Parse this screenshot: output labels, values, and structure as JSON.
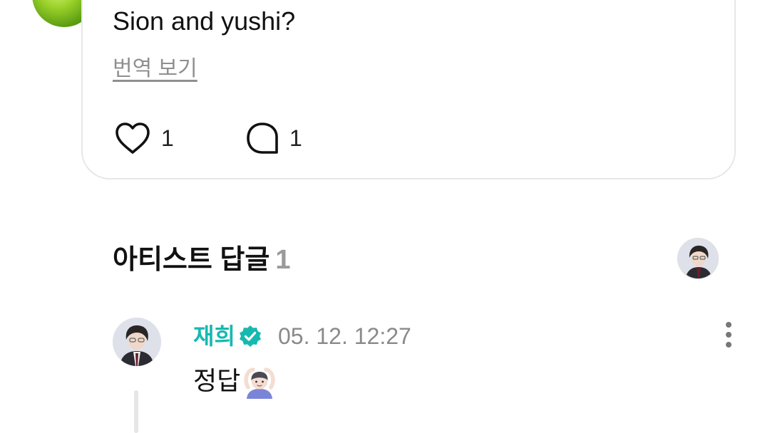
{
  "post": {
    "text": "Sion and yushi?",
    "translate_label": "번역 보기",
    "likes": "1",
    "comments": "1"
  },
  "artist_replies": {
    "title": "아티스트 답글",
    "count": "1"
  },
  "reply": {
    "author": "재희",
    "timestamp": "05. 12. 12:27",
    "text": "정답",
    "emoji": "person-gesturing-ok"
  },
  "colors": {
    "author_accent": "#16b9b0",
    "muted_text": "#8a8a8a",
    "card_border": "#e7e7e7"
  },
  "icons": [
    "heart-icon",
    "comment-bubble-icon",
    "verified-badge-icon",
    "more-options-icon"
  ]
}
